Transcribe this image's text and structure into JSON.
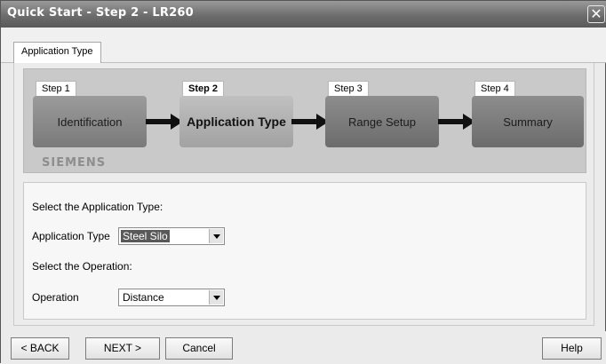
{
  "window": {
    "title": "Quick Start - Step 2 - LR260",
    "close_glyph": "✕"
  },
  "tabs": [
    {
      "label": "Application Type"
    }
  ],
  "steps": [
    {
      "label": "Step 1",
      "name": "Identification"
    },
    {
      "label": "Step 2",
      "name": "Application Type"
    },
    {
      "label": "Step 3",
      "name": "Range Setup"
    },
    {
      "label": "Step 4",
      "name": "Summary"
    }
  ],
  "brand": "SIEMENS",
  "form": {
    "application_prompt": "Select the Application Type:",
    "application_label": "Application Type",
    "application_value": "Steel Silo",
    "operation_prompt": "Select the Operation:",
    "operation_label": "Operation",
    "operation_value": "Distance"
  },
  "buttons": {
    "back": "< BACK",
    "next": "NEXT >",
    "cancel": "Cancel",
    "help": "Help"
  }
}
